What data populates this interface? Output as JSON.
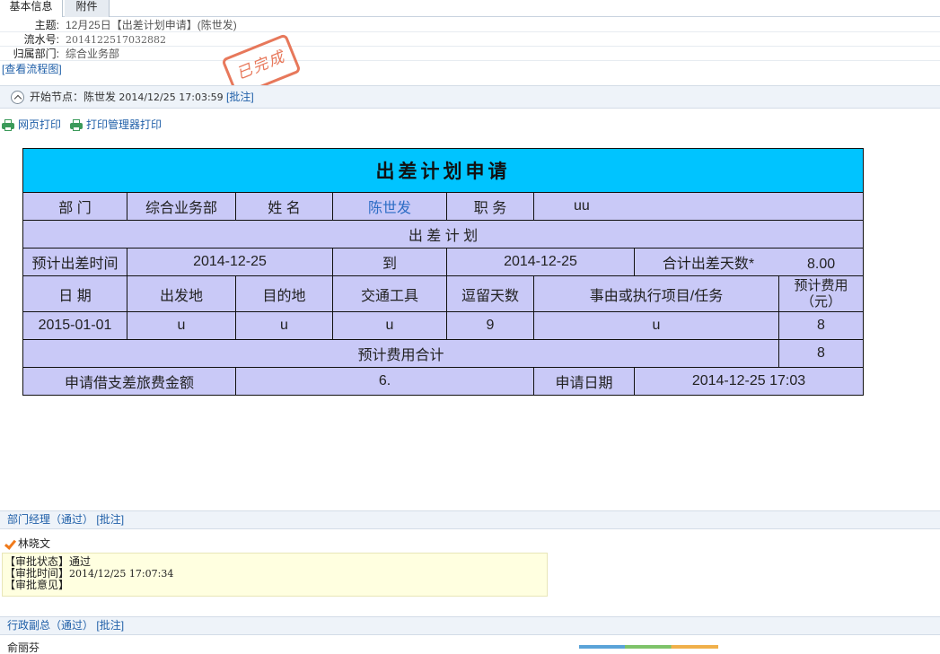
{
  "tabs": [
    "基本信息",
    "附件"
  ],
  "meta": {
    "subject_label": "主题:",
    "subject": "12月25日【出差计划申请】(陈世发)",
    "serial_label": "流水号:",
    "serial": "2014122517032882",
    "dept_label": "归属部门:",
    "dept": "综合业务部",
    "flow_link": "[查看流程图]"
  },
  "stamp": "已完成",
  "start_node": {
    "text": "开始节点：陈世发",
    "time": "2014/12/25 17:03:59",
    "comment": "[批注]"
  },
  "print": {
    "web": "网页打印",
    "manager": "打印管理器打印"
  },
  "form": {
    "title": "出差计划申请",
    "dept_label": "部 门",
    "dept_value": "综合业务部",
    "name_label": "姓 名",
    "name_value": "陈世发",
    "position_label": "职 务",
    "position_value": "uu",
    "plan_header": "出 差 计 划",
    "est_time_label": "预计出差时间",
    "start_date": "2014-12-25",
    "to_label": "到",
    "end_date": "2014-12-25",
    "days_label": "合计出差天数*",
    "days_value": "8.00",
    "cols": {
      "date": "日 期",
      "from": "出发地",
      "dest": "目的地",
      "transport": "交通工具",
      "stay": "逗留天数",
      "reason": "事由或执行项目/任务",
      "cost_1": "预计费用",
      "cost_2": "（元）"
    },
    "row": {
      "date": "2015-01-01",
      "from": "u",
      "dest": "u",
      "transport": "u",
      "stay": "9",
      "reason": "u",
      "cost": "8"
    },
    "total_label": "预计费用合计",
    "total_value": "8",
    "loan_label": "申请借支差旅费金额",
    "loan_value": "6.",
    "apply_date_label": "申请日期",
    "apply_date_value": "2014-12-25 17:03"
  },
  "approvals": {
    "dept_manager": "部门经理（通过）",
    "comment": "[批注]",
    "approver": "林晓文",
    "status_line": "【审批状态】通过",
    "time_label": "【审批时间】",
    "time_value": "2014/12/25 17:07:34",
    "opinion": "【审批意见】",
    "admin_vp": "行政副总（通过）",
    "admin_comment": "[批注]",
    "next_approver": "俞丽芬"
  }
}
